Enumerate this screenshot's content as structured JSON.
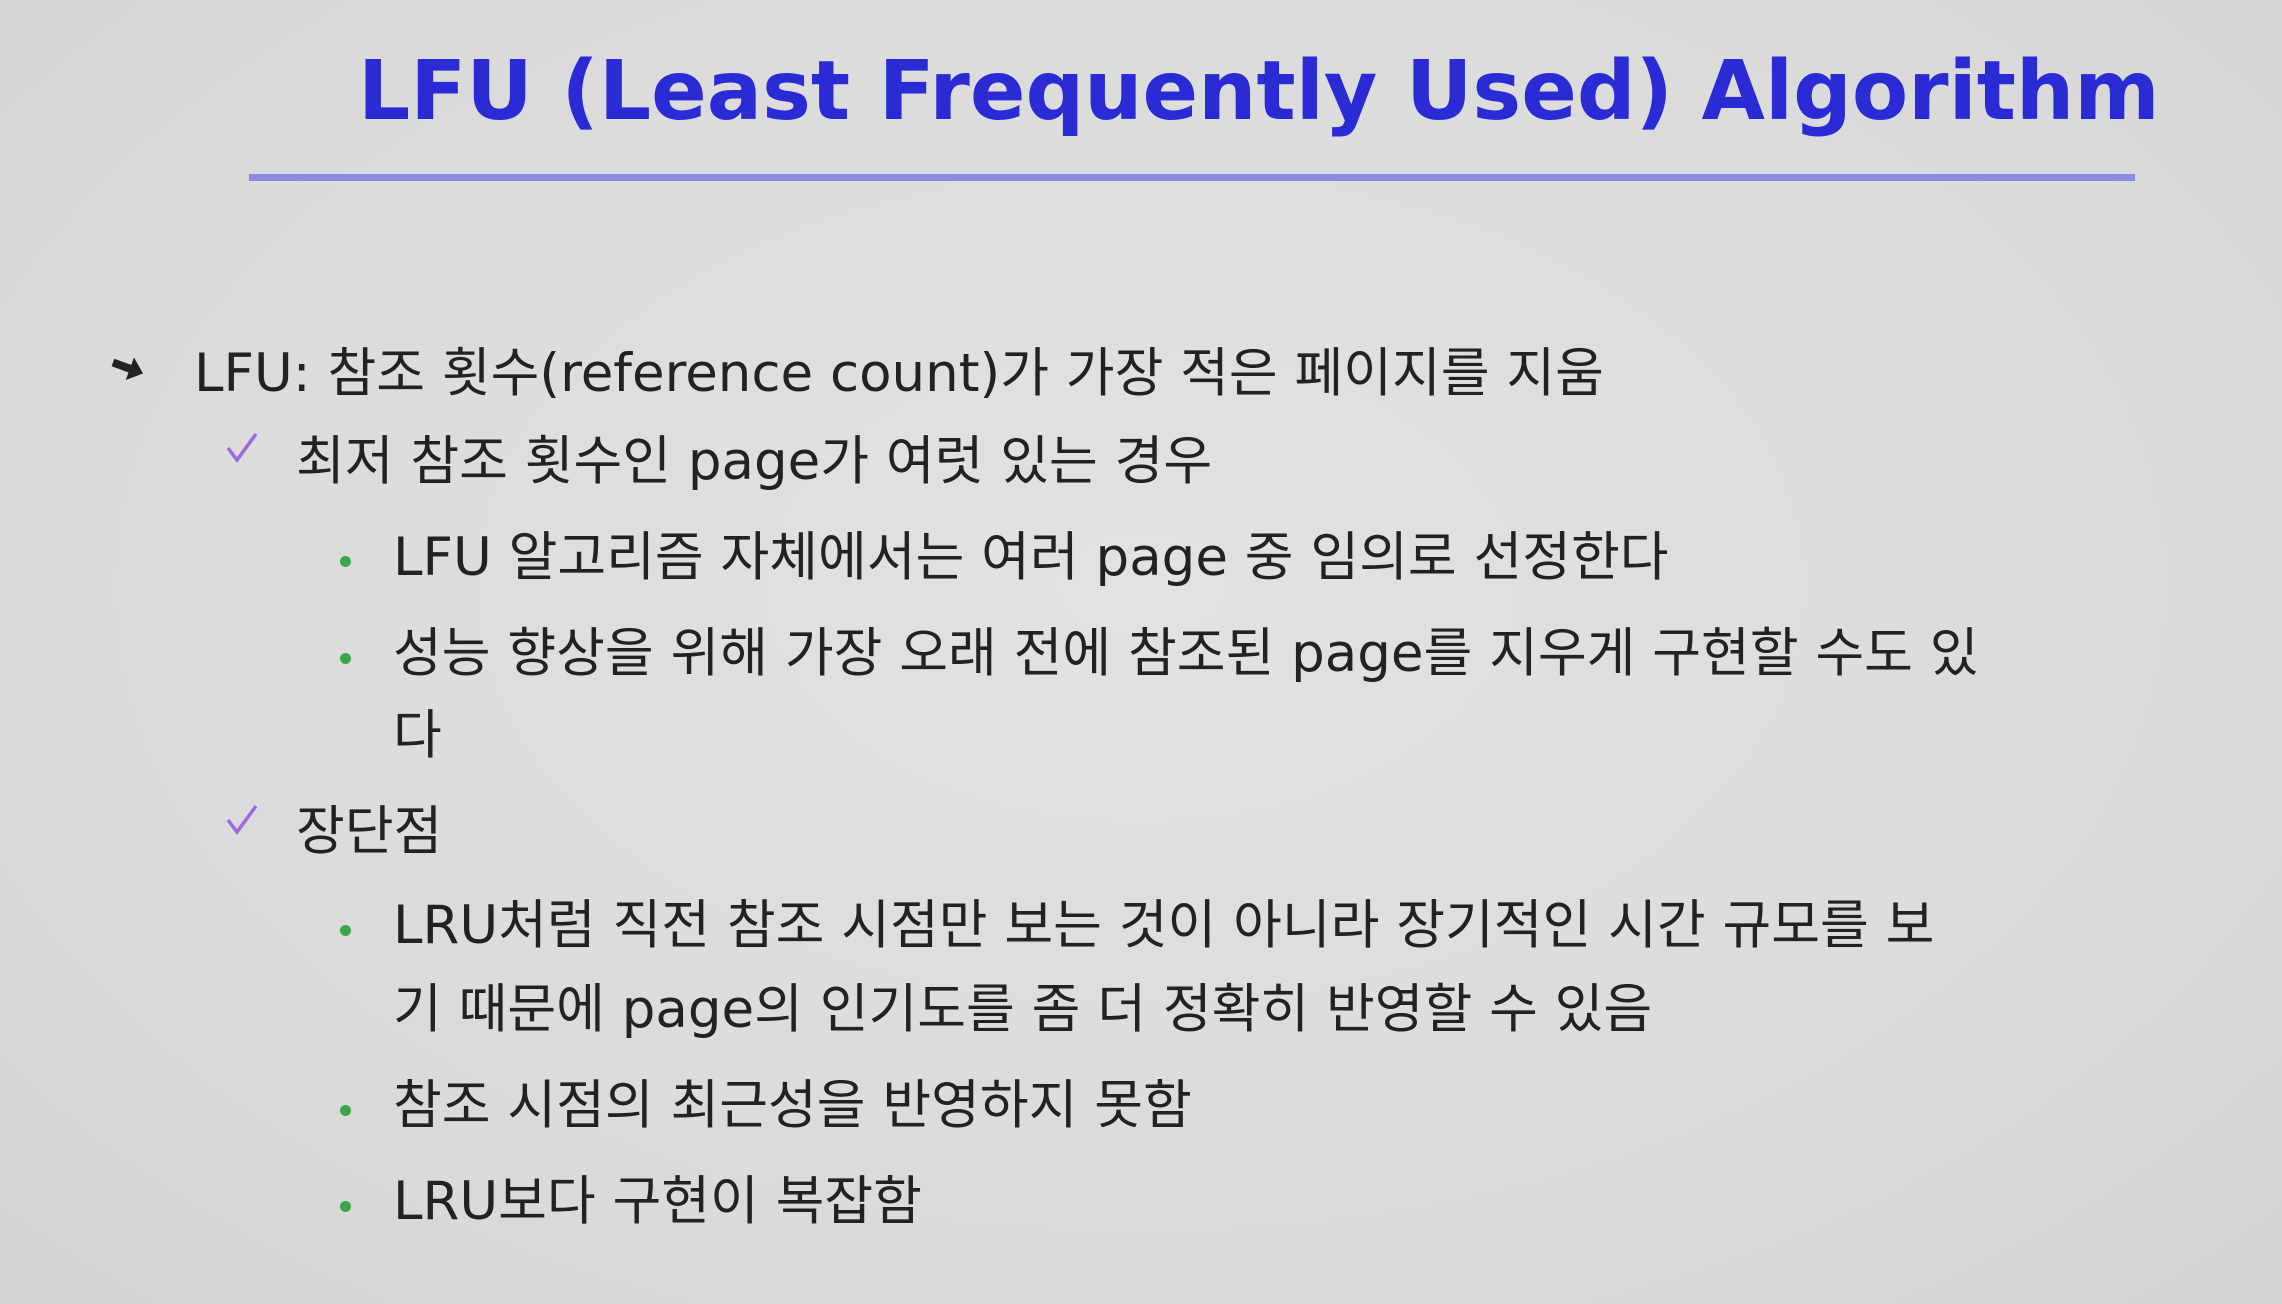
{
  "slide": {
    "title": "LFU (Least Frequently Used) Algorithm",
    "level1": {
      "text": "LFU: 참조 횟수(reference count)가 가장 적은 페이지를 지움"
    },
    "sub1": {
      "text": "최저 참조 횟수인 page가 여럿 있는 경우",
      "bullets": [
        "LFU 알고리즘 자체에서는 여러 page 중 임의로 선정한다",
        "성능 향상을 위해 가장 오래 전에 참조된 page를 지우게 구현할 수도 있",
        "다"
      ]
    },
    "sub2": {
      "text": "장단점",
      "bullets": [
        "LRU처럼 직전 참조 시점만 보는 것이 아니라 장기적인 시간 규모를 보",
        "기 때문에 page의 인기도를 좀 더 정확히 반영할 수 있음",
        "참조 시점의 최근성을 반영하지 못함",
        "LRU보다 구현이 복잡함"
      ]
    },
    "icons": {
      "level1_bullet": "arrow-bullet-icon",
      "sub_bullet": "checkmark-icon",
      "item_bullet": "green-dot-icon"
    },
    "colors": {
      "title": "#2b2bd6",
      "rule": "#8a8ae0",
      "check": "#9a6adf",
      "dot": "#3aa84a",
      "background": "#dcdcdc"
    }
  }
}
